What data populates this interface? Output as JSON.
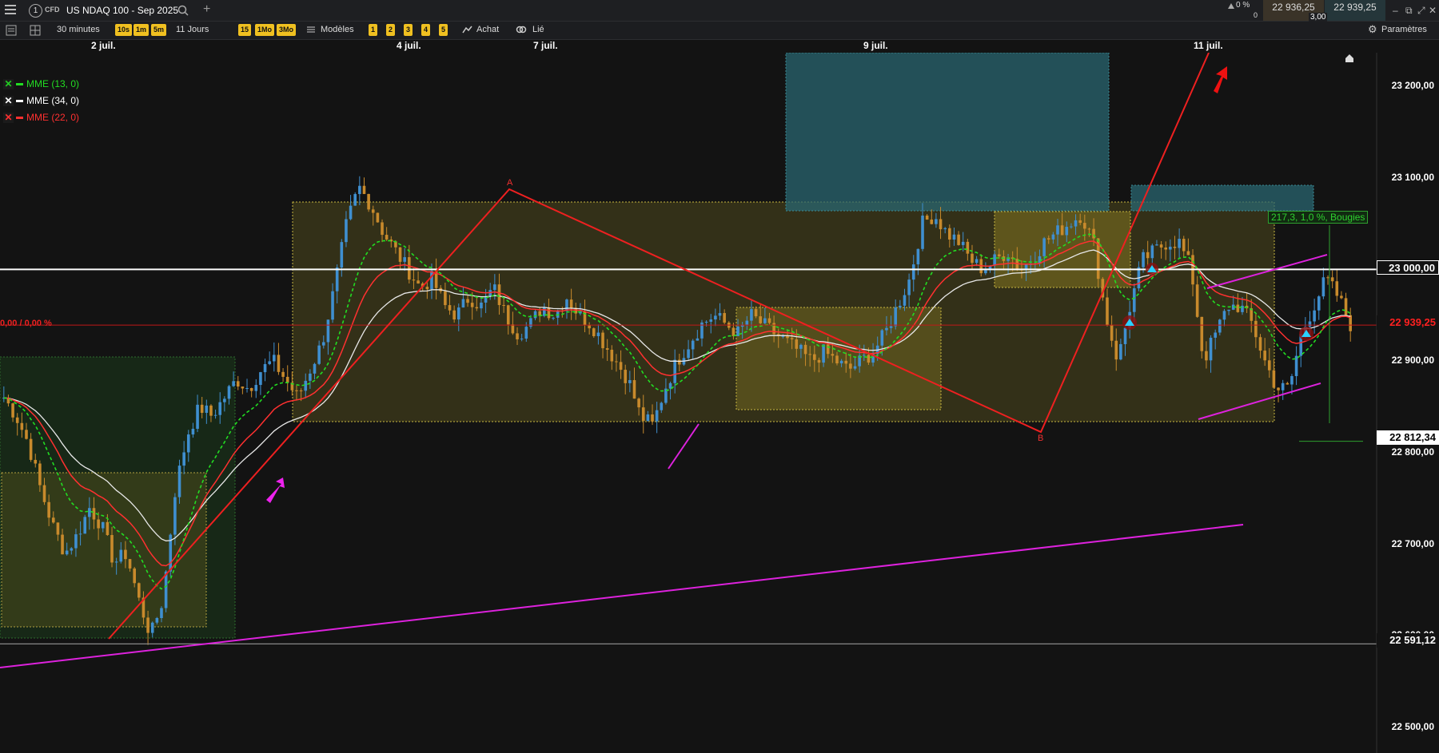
{
  "header": {
    "tab_number": "1",
    "tab_type": "CFD",
    "instrument": "US NDAQ 100 - Sep 2025",
    "change_pct": "0 %",
    "change_value": "0",
    "bid": "22 936,25",
    "ask": "22 939,25",
    "spread": "3,00"
  },
  "toolbar": {
    "timeframe": "30 minutes",
    "intervals": [
      "10s",
      "1m",
      "5m"
    ],
    "range": "11 Jours",
    "periods": [
      "15",
      "1Mo",
      "3Mo"
    ],
    "models_label": "Modèles",
    "slots": [
      "1",
      "2",
      "3",
      "4",
      "5"
    ],
    "buy_label": "Achat",
    "link_label": "Lié",
    "settings_label": "Paramètres"
  },
  "chart_data": {
    "type": "candlestick",
    "instrument": "US NDAQ 100 - Sep 2025",
    "interval": "30 minutes",
    "x_labels": [
      "2 juil.",
      "4 juil.",
      "7 juil.",
      "9 juil.",
      "11 juil."
    ],
    "y_ticks": [
      "23 200,00",
      "23 100,00",
      "23 000,00",
      "22 900,00",
      "22 800,00",
      "22 700,00",
      "22 600,00",
      "22 500,00"
    ],
    "ylim": [
      22475,
      23235
    ],
    "indicators": [
      {
        "name": "MME (13, 0)",
        "color": "#22dd22",
        "style": "dashed"
      },
      {
        "name": "MME (34, 0)",
        "color": "#e8e8e8",
        "style": "solid"
      },
      {
        "name": "MME (22, 0)",
        "color": "#ff3030",
        "style": "solid"
      }
    ],
    "price_lines": [
      {
        "label": "23 000,00",
        "value": 23000,
        "color": "#ffffff"
      },
      {
        "label": "22 939,25",
        "value": 22939.25,
        "color": "#ff2020"
      },
      {
        "label": "22 812,34",
        "value": 22812.34,
        "color": "#ffffff"
      },
      {
        "label": "22 591,12",
        "value": 22591.12,
        "color": "#ffffff"
      }
    ],
    "left_price_label": "0,00 / 0,00 %",
    "measure_label": "217,3, 1,0 %, Bougies",
    "pattern_labels": [
      "A",
      "B"
    ],
    "price_path": [
      22860,
      22840,
      22810,
      22760,
      22720,
      22690,
      22710,
      22740,
      22720,
      22680,
      22690,
      22640,
      22600,
      22640,
      22760,
      22820,
      22850,
      22840,
      22860,
      22880,
      22870,
      22890,
      22900,
      22880,
      22860,
      22890,
      22920,
      22980,
      23050,
      23090,
      23070,
      23040,
      23020,
      23000,
      22980,
      22990,
      22960,
      22950,
      22970,
      22960,
      22980,
      22950,
      22930,
      22940,
      22960,
      22950,
      22970,
      22950,
      22940,
      22920,
      22900,
      22880,
      22840,
      22830,
      22870,
      22900,
      22920,
      22940,
      22950,
      22940,
      22930,
      22950,
      22940,
      22930,
      22920,
      22910,
      22900,
      22910,
      22900,
      22890,
      22900,
      22910,
      22930,
      22960,
      22990,
      23050,
      23060,
      23040,
      23030,
      23010,
      23000,
      23010,
      23020,
      23000,
      23010,
      23030,
      23040,
      23050,
      23060,
      23030,
      22950,
      22900,
      22960,
      23010,
      23020,
      23030,
      23030,
      23000,
      22900,
      22930,
      22960,
      22960,
      22940,
      22900,
      22870,
      22870,
      22930,
      22960,
      22990,
      22970,
      22940
    ]
  }
}
